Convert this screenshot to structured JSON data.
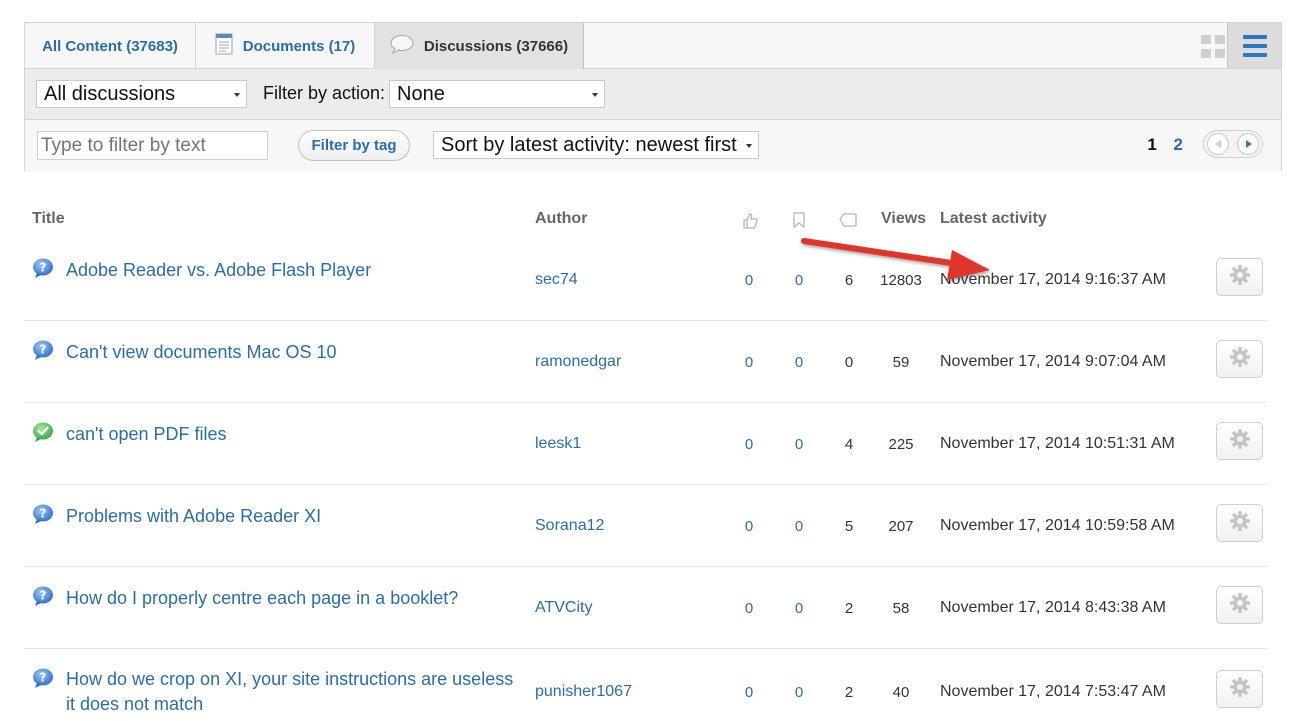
{
  "tabs": [
    {
      "label": "All Content (37683)",
      "icon": "none"
    },
    {
      "label": "Documents (17)",
      "icon": "document-icon"
    },
    {
      "label": "Discussions (37666)",
      "icon": "speech-bubble-icon"
    }
  ],
  "view_toggle": {
    "grid_icon": "grid-view-icon",
    "list_icon": "list-view-icon"
  },
  "filters": {
    "discussion_select": "All discussions",
    "action_label": "Filter by action:",
    "action_select": "None",
    "text_placeholder": "Type to filter by text",
    "tag_button": "Filter by tag",
    "sort_select": "Sort by latest activity: newest first"
  },
  "pagination": {
    "current": "1",
    "next_page": "2"
  },
  "table": {
    "headers": {
      "title": "Title",
      "author": "Author",
      "likes_icon": "thumbs-up-icon",
      "bookmarks_icon": "bookmark-icon",
      "replies_icon": "reply-icon",
      "views": "Views",
      "activity": "Latest activity"
    },
    "rows": [
      {
        "status": "question-icon",
        "title": "Adobe Reader vs. Adobe Flash Player",
        "author": "sec74",
        "likes": "0",
        "bookmarks": "0",
        "replies": "6",
        "views": "12803",
        "activity": "November 17, 2014 9:16:37 AM"
      },
      {
        "status": "question-icon",
        "title": "Can't view documents Mac OS 10",
        "author": "ramonedgar",
        "likes": "0",
        "bookmarks": "0",
        "replies": "0",
        "views": "59",
        "activity": "November 17, 2014 9:07:04 AM"
      },
      {
        "status": "answered-icon",
        "title": "can't open PDF files",
        "author": "leesk1",
        "likes": "0",
        "bookmarks": "0",
        "replies": "4",
        "views": "225",
        "activity": "November 17, 2014 10:51:31 AM"
      },
      {
        "status": "question-icon",
        "title": "Problems with Adobe Reader XI",
        "author": "Sorana12",
        "likes": "0",
        "bookmarks": "0",
        "replies": "5",
        "views": "207",
        "activity": "November 17, 2014 10:59:58 AM"
      },
      {
        "status": "question-icon",
        "title": "How do I properly centre each page in a booklet?",
        "author": "ATVCity",
        "likes": "0",
        "bookmarks": "0",
        "replies": "2",
        "views": "58",
        "activity": "November 17, 2014 8:43:38 AM"
      },
      {
        "status": "question-icon",
        "title": "How do we crop on XI, your site instructions are useless it does not match",
        "author": "punisher1067",
        "likes": "0",
        "bookmarks": "0",
        "replies": "2",
        "views": "40",
        "activity": "November 17, 2014 7:53:47 AM"
      }
    ]
  },
  "row_action_icon": "gear-icon",
  "annotation": {
    "icon": "red-arrow-icon",
    "color": "#e0352b"
  },
  "colors": {
    "link": "#2d6ca8",
    "accent": "#2f76c2",
    "answered": "#3aa64a"
  }
}
